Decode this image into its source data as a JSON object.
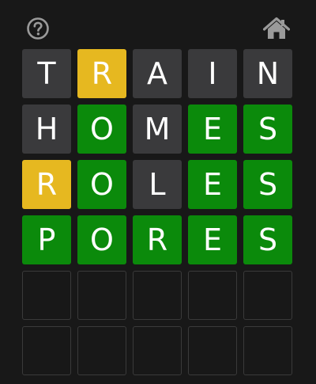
{
  "icons": {
    "help": "question-circle-icon",
    "home": "house-icon"
  },
  "colors": {
    "background": "#181818",
    "absent": "#3a3a3c",
    "present": "#e6b820",
    "correct": "#0b8a0b",
    "empty_border": "#3a3a3a",
    "icon": "#9a9a9a"
  },
  "board": {
    "rows": [
      {
        "tiles": [
          {
            "letter": "T",
            "state": "absent"
          },
          {
            "letter": "R",
            "state": "present"
          },
          {
            "letter": "A",
            "state": "absent"
          },
          {
            "letter": "I",
            "state": "absent"
          },
          {
            "letter": "N",
            "state": "absent"
          }
        ]
      },
      {
        "tiles": [
          {
            "letter": "H",
            "state": "absent"
          },
          {
            "letter": "O",
            "state": "correct"
          },
          {
            "letter": "M",
            "state": "absent"
          },
          {
            "letter": "E",
            "state": "correct"
          },
          {
            "letter": "S",
            "state": "correct"
          }
        ]
      },
      {
        "tiles": [
          {
            "letter": "R",
            "state": "present"
          },
          {
            "letter": "O",
            "state": "correct"
          },
          {
            "letter": "L",
            "state": "absent"
          },
          {
            "letter": "E",
            "state": "correct"
          },
          {
            "letter": "S",
            "state": "correct"
          }
        ]
      },
      {
        "tiles": [
          {
            "letter": "P",
            "state": "correct"
          },
          {
            "letter": "O",
            "state": "correct"
          },
          {
            "letter": "R",
            "state": "correct"
          },
          {
            "letter": "E",
            "state": "correct"
          },
          {
            "letter": "S",
            "state": "correct"
          }
        ]
      },
      {
        "tiles": [
          {
            "letter": "",
            "state": "empty"
          },
          {
            "letter": "",
            "state": "empty"
          },
          {
            "letter": "",
            "state": "empty"
          },
          {
            "letter": "",
            "state": "empty"
          },
          {
            "letter": "",
            "state": "empty"
          }
        ]
      },
      {
        "tiles": [
          {
            "letter": "",
            "state": "empty"
          },
          {
            "letter": "",
            "state": "empty"
          },
          {
            "letter": "",
            "state": "empty"
          },
          {
            "letter": "",
            "state": "empty"
          },
          {
            "letter": "",
            "state": "empty"
          }
        ]
      }
    ]
  }
}
